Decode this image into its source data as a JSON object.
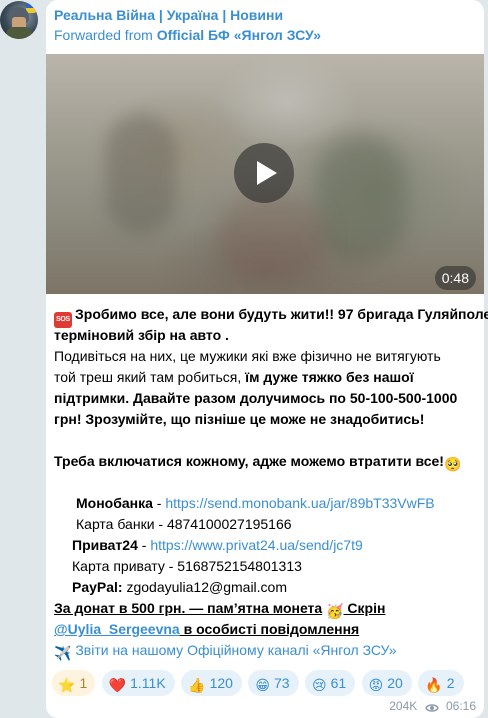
{
  "post": {
    "channel_name": "Реальна Війна | Україна | Новини",
    "forwarded_prefix": "Forwarded from ",
    "forwarded_source": "Official БФ «Янгол ЗСУ»",
    "video_duration": "0:48",
    "lines": {
      "l1a": "Зробимо все, але вони будуть жити!! 97 бригада Гуляйполе",
      "l1b": "терміновий збір на авто .",
      "l2": "Подивіться на них, це мужики які вже фізично не витягують",
      "l3a": "той треш який там робиться, ",
      "l3b": "їм дуже тяжко без нашої",
      "l4": "підтримки. Давайте разом долучимось по 50-100-500-1000",
      "l5": "грн! Зрозумійте, що пізніше це може не знадобитись!",
      "l6": "Треба включатися кожному, адже можемо втратити все!",
      "mono_label": "Монобанка",
      "mono_sep": " - ",
      "mono_link": "https://send.monobank.ua/jar/89bT33VwFB",
      "card1": "Карта банки - 4874100027195166",
      "privat_label": "Приват24",
      "privat_sep": " - ",
      "privat_link": "https://www.privat24.ua/send/jc7t9",
      "card2": "Карта привату - 5168752154801313",
      "paypal_label": "PayPal:",
      "paypal_value": " zgodayulia12@gmail.com",
      "donate_a": "За донат в 500 грн. — пам’ятна монета",
      "donate_b": " Скрін",
      "mention": "@Uylia_Sergeevna",
      "mention_tail": " в особисті повідомлення",
      "reports": "Звіти на нашому Офіційному каналі «Янгол ЗСУ»"
    }
  },
  "emoji": {
    "sos": "SOS",
    "pleading": "🥺",
    "party": "🥳",
    "plane": "✈️"
  },
  "reactions": [
    {
      "icon": "⭐",
      "count": "1"
    },
    {
      "icon": "❤️",
      "count": "1.11K"
    },
    {
      "icon": "👍",
      "count": "120"
    },
    {
      "icon": "😁",
      "count": "73"
    },
    {
      "icon": "😢",
      "count": "61"
    },
    {
      "icon": "😡",
      "count": "20"
    },
    {
      "icon": "🔥",
      "count": "2"
    }
  ],
  "meta": {
    "views": "204K",
    "time": "06:16"
  },
  "colors": {
    "link": "#3a8fd0",
    "background": "#dfe7ea",
    "bubble": "#ffffff"
  }
}
